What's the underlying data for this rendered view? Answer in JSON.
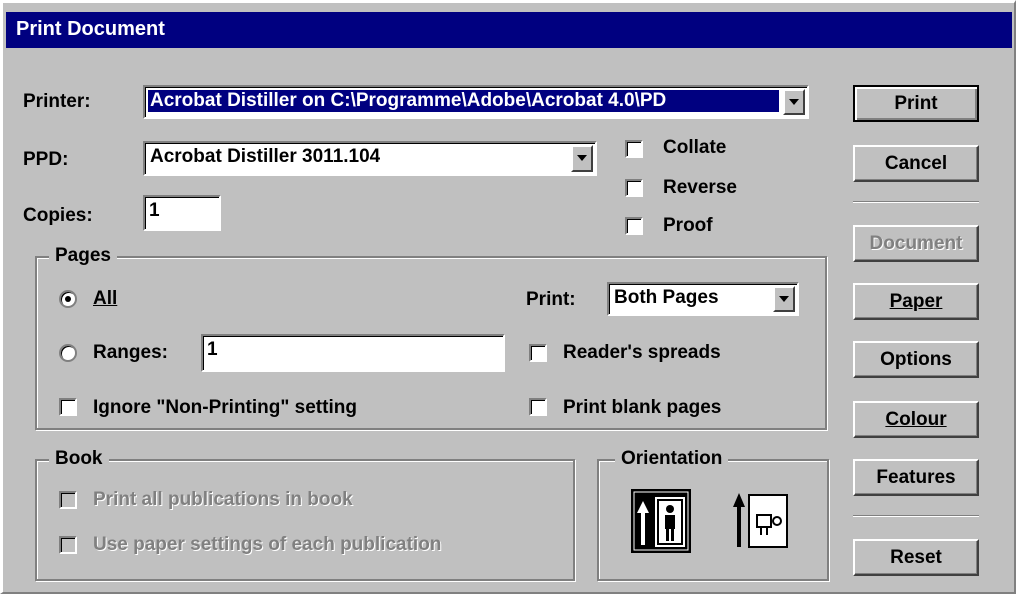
{
  "window": {
    "title": "Print Document"
  },
  "printer": {
    "label": "Printer:",
    "value": "Acrobat Distiller on C:\\Programme\\Adobe\\Acrobat 4.0\\PD"
  },
  "ppd": {
    "label": "PPD:",
    "value": "Acrobat Distiller 3011.104"
  },
  "copies": {
    "label": "Copies:",
    "value": "1"
  },
  "options": {
    "collate": "Collate",
    "reverse": "Reverse",
    "proof": "Proof"
  },
  "pages": {
    "title": "Pages",
    "all_label": "All",
    "ranges_label": "Ranges:",
    "ranges_value": "1",
    "ignore_nonprinting": "Ignore \"Non-Printing\" setting",
    "print_label": "Print:",
    "print_value": "Both Pages",
    "readers_spreads": "Reader's spreads",
    "print_blank": "Print blank pages",
    "selected": "All"
  },
  "book": {
    "title": "Book",
    "print_all": "Print all publications in book",
    "use_paper": "Use paper settings of each publication"
  },
  "orientation": {
    "title": "Orientation"
  },
  "buttons": {
    "print": "Print",
    "cancel": "Cancel",
    "document": "Document",
    "paper": "Paper",
    "options": "Options",
    "colour": "Colour",
    "features": "Features",
    "reset": "Reset"
  },
  "colors": {
    "title_bar": "#000080",
    "face": "#c0c0c0",
    "disabled": "#808080"
  }
}
